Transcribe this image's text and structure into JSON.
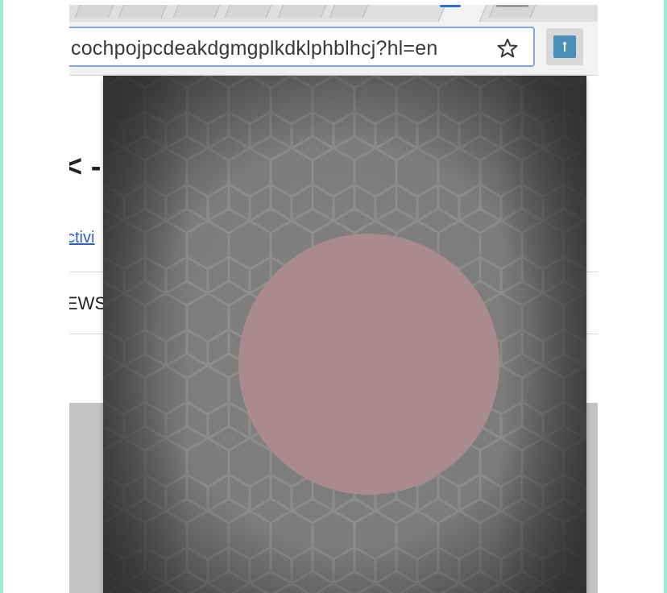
{
  "browser": {
    "address_bar": {
      "url_text": "cochpojpcdeakdgmgplkdklphblhcj?hl=en"
    },
    "bookmark_icon": "star-icon",
    "extension_icon": "extension-icon",
    "accent_color": "#7ba7ef"
  },
  "page": {
    "heading_fragment": "< -",
    "link_fragment": "ctivi",
    "nav_fragment": "EWS"
  },
  "popup": {
    "background_pattern": "hexagon",
    "record_button_icon": "record-circle",
    "record_color": "#a98a8e"
  }
}
